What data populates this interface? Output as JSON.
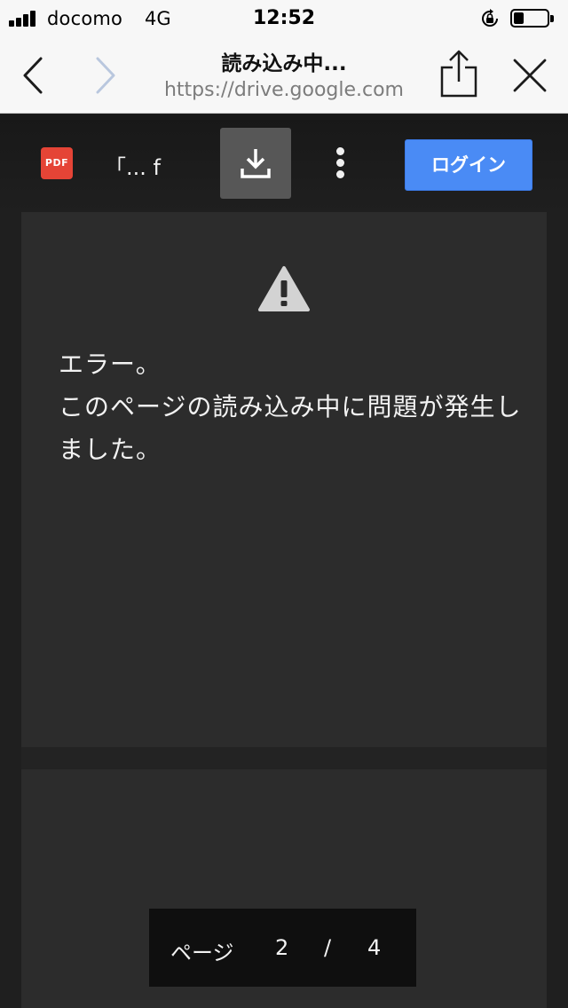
{
  "status_bar": {
    "carrier": "docomo",
    "network": "4G",
    "time": "12:52",
    "battery_level": 0.3
  },
  "browser": {
    "title": "読み込み中...",
    "url": "https://drive.google.com",
    "icons": {
      "back": "chevron-left-icon",
      "forward": "chevron-right-icon",
      "share": "share-icon",
      "close": "close-icon"
    }
  },
  "viewer": {
    "file_type_badge": "PDF",
    "file_title": "「... f",
    "login_label": "ログイン",
    "accent_color": "#4a8bf5",
    "pdf_color": "#e54436"
  },
  "error": {
    "line1": "エラー。",
    "line2": "このページの読み込み中に問題が発生し",
    "line3": "ました。"
  },
  "page_indicator": {
    "label": "ページ",
    "current": "2",
    "separator": "/",
    "total": "4"
  }
}
